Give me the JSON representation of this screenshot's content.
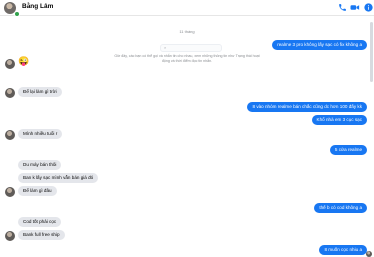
{
  "header": {
    "contact_name": "Bằng Lâm",
    "icons": {
      "call": "phone-icon",
      "video": "video-camera-icon",
      "info": "info-icon"
    },
    "accent_color": "#1877f2"
  },
  "thread": {
    "timestamp": "11 tháng",
    "notice": "Giờ đây, các bạn có thể gọi và nhắn tin cho nhau, xem những thông tin như Trạng thái hoạt động và thời điểm đọc tin nhắn."
  },
  "messages": [
    {
      "from": "me",
      "text": "realme 3 pro không lấy sạc có fix không a"
    },
    {
      "from": "them",
      "text": "😜"
    },
    {
      "from": "them",
      "text": "Để lại làm gì trời"
    },
    {
      "from": "me",
      "text": "8 vào nhóm realme bán chắc cũng dc hơn 100 đấy kk"
    },
    {
      "from": "me",
      "text": "Khổ nhà em 3 cục sạc"
    },
    {
      "from": "them",
      "text": "Mình nhiều tuổi r"
    },
    {
      "from": "me",
      "text": "5 cửa realme"
    },
    {
      "from": "them",
      "text": "Du máy bán thôi"
    },
    {
      "from": "them",
      "text": "Ban k lấy sạc mình vẫn bán giá đó"
    },
    {
      "from": "them",
      "text": "Để làm gì đâu"
    },
    {
      "from": "me",
      "text": "thế b có cod không a"
    },
    {
      "from": "them",
      "text": "Cod tốt phải cọc"
    },
    {
      "from": "them",
      "text": "Bank full free ship"
    },
    {
      "from": "me",
      "text": "8 muốn cọc nhiu a"
    }
  ]
}
